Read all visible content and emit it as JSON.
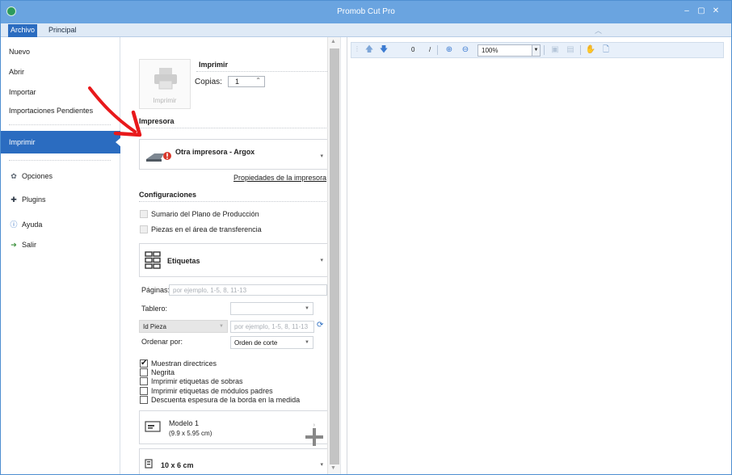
{
  "window": {
    "title": "Promob Cut Pro",
    "controls": [
      "–",
      "▢",
      "✕"
    ]
  },
  "ribbon": {
    "tabs": [
      "Archivo",
      "Principal"
    ],
    "active_tab": "Archivo",
    "collapse_icon": "chevron-up-icon"
  },
  "nav": {
    "items": [
      "Nuevo",
      "Abrir",
      "Importar",
      "Importaciones Pendientes"
    ],
    "active": "Imprimir",
    "secondary": [
      {
        "label": "Opciones",
        "icon": "gear-icon"
      },
      {
        "label": "Plugins",
        "icon": "puzzle-icon"
      },
      {
        "label": "Ayuda",
        "icon": "help-icon"
      },
      {
        "label": "Salir",
        "icon": "exit-icon"
      }
    ]
  },
  "print": {
    "title": "Imprimir",
    "button_label": "Imprimir",
    "copies_label": "Copias:",
    "copies_value": "1",
    "printer_section": "Impresora",
    "printer_name": "Otra impresora - Argox",
    "printer_properties": "Propiedades de la impresora",
    "config_section": "Configuraciones",
    "options": [
      {
        "label": "Sumario del Plano de Producción",
        "checked": false,
        "enabled": false
      },
      {
        "label": "Piezas en el área de transferencia",
        "checked": false,
        "enabled": false
      }
    ],
    "layout_type": "Etiquetas",
    "pages_label": "Páginas:",
    "pages_placeholder": "por ejemplo, 1-5, 8, 11-13",
    "tablero_label": "Tablero:",
    "tablero_value": "",
    "id_select": "Id Pieza",
    "id_placeholder": "por ejemplo, 1-5, 8, 11-13",
    "order_label": "Ordenar por:",
    "order_value": "Orden de corte",
    "flags": [
      {
        "label": "Muestran directrices",
        "checked": true
      },
      {
        "label": "Negrita",
        "checked": false
      },
      {
        "label": "Imprimir etiquetas de sobras",
        "checked": false
      },
      {
        "label": "Imprimir etiquetas de módulos padres",
        "checked": false
      },
      {
        "label": "Descuenta espesura de la borda en la medida",
        "checked": false
      }
    ],
    "model_name": "Modelo 1",
    "model_size": "(9.9 x 5.95 cm)",
    "paper_size": "10 x 6 cm"
  },
  "preview": {
    "page_value": "0",
    "page_separator": "/",
    "zoom_value": "100%",
    "toolbar_icons": [
      "arrow-up-icon",
      "arrow-down-icon",
      "zoom-in-icon",
      "zoom-out-icon",
      "fit-page-icon",
      "fit-width-icon",
      "pan-hand-icon",
      "page-setup-icon"
    ]
  },
  "colors": {
    "title_bar": "#6aa4e0",
    "accent": "#2b6cc0",
    "annotation": "#e8191b"
  }
}
